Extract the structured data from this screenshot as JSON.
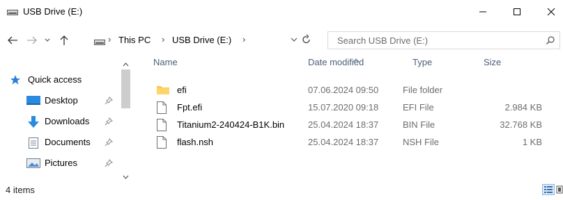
{
  "window": {
    "title": "USB Drive (E:)",
    "controls": {
      "minimize": "—",
      "maximize": "☐",
      "close": "✕"
    }
  },
  "nav_buttons": {
    "back": "←",
    "forward": "→",
    "recent": "⌄",
    "up": "↑"
  },
  "address": {
    "crumbs": [
      "This PC",
      "USB Drive (E:)"
    ],
    "separator": "›"
  },
  "search": {
    "placeholder": "Search USB Drive (E:)"
  },
  "sidebar": {
    "items": [
      {
        "label": "Quick access",
        "icon": "star-icon",
        "pinned": false
      },
      {
        "label": "Desktop",
        "icon": "desktop-icon",
        "pinned": true
      },
      {
        "label": "Downloads",
        "icon": "download-arrow-icon",
        "pinned": true
      },
      {
        "label": "Documents",
        "icon": "documents-icon",
        "pinned": true
      },
      {
        "label": "Pictures",
        "icon": "pictures-icon",
        "pinned": true
      }
    ]
  },
  "columns": {
    "name": "Name",
    "date": "Date modified",
    "type": "Type",
    "size": "Size"
  },
  "files": [
    {
      "name": "efi",
      "date": "07.06.2024 09:50",
      "type": "File folder",
      "size": "",
      "icon": "folder-icon"
    },
    {
      "name": "Fpt.efi",
      "date": "15.07.2020 09:18",
      "type": "EFI File",
      "size": "2.984 KB",
      "icon": "file-icon"
    },
    {
      "name": "Titanium2-240424-B1K.bin",
      "date": "25.04.2024 18:37",
      "type": "BIN File",
      "size": "32.768 KB",
      "icon": "file-icon"
    },
    {
      "name": "flash.nsh",
      "date": "25.04.2024 18:37",
      "type": "NSH File",
      "size": "1 KB",
      "icon": "file-icon"
    }
  ],
  "status": {
    "item_count": "4 items"
  },
  "colors": {
    "accent": "#0078d7",
    "folder": "#f8c94b",
    "header_text": "#4c607a"
  }
}
